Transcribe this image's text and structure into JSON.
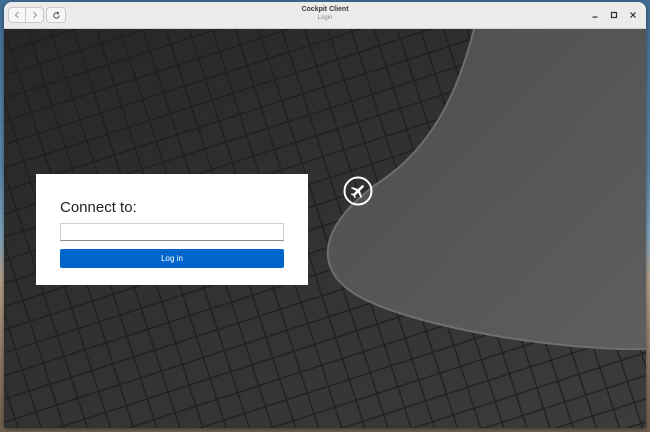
{
  "window": {
    "title": "Cockpit Client",
    "subtitle": "Login"
  },
  "toolbar": {
    "back_icon": "chevron-left-icon",
    "forward_icon": "chevron-right-icon",
    "reload_icon": "reload-icon"
  },
  "window_controls": {
    "minimize_icon": "minimize-icon",
    "maximize_icon": "maximize-icon",
    "close_icon": "close-icon"
  },
  "login": {
    "heading": "Connect to:",
    "host_value": "",
    "button_label": "Log in",
    "accent_color": "#0066cc"
  },
  "badge": {
    "icon": "airplane-icon"
  }
}
